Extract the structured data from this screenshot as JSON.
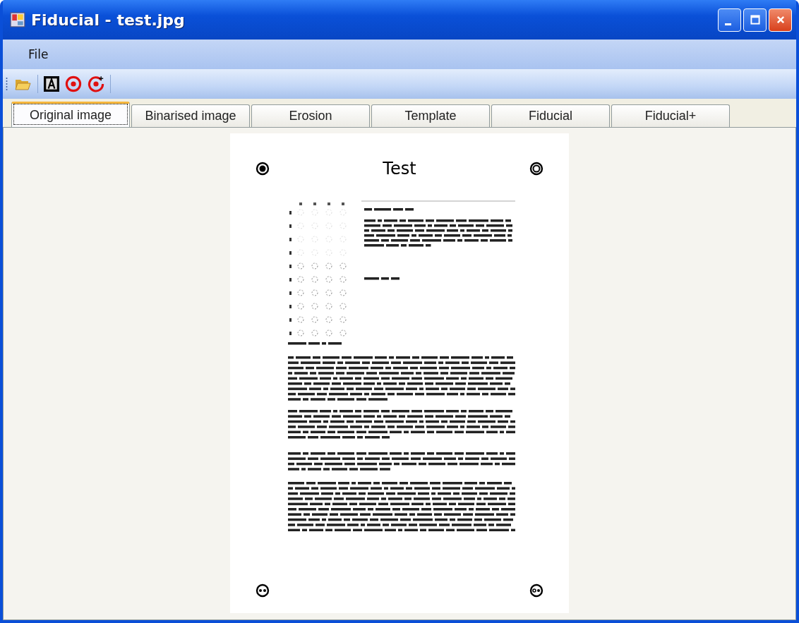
{
  "window": {
    "title": "Fiducial - test.jpg"
  },
  "menu": [
    {
      "label": "File"
    }
  ],
  "tabs": [
    {
      "label": "Original image",
      "selected": true
    },
    {
      "label": "Binarised image",
      "selected": false
    },
    {
      "label": "Erosion",
      "selected": false
    },
    {
      "label": "Template",
      "selected": false
    },
    {
      "label": "Fiducial",
      "selected": false
    },
    {
      "label": "Fiducial+",
      "selected": false
    }
  ],
  "document": {
    "title": "Test"
  }
}
